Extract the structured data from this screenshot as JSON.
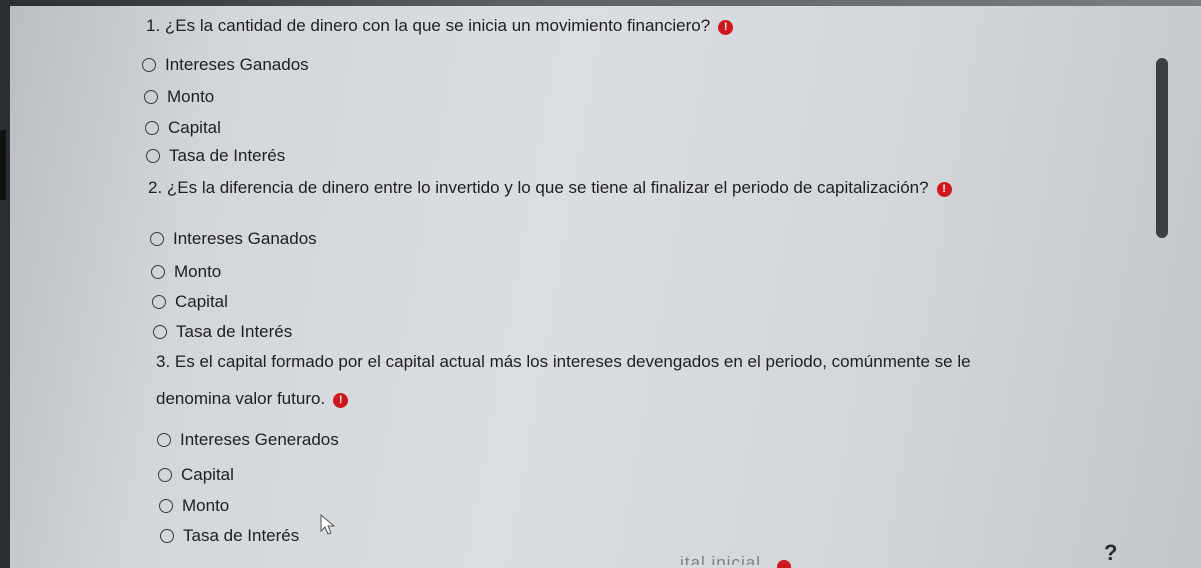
{
  "questions": [
    {
      "text": "1. ¿Es la cantidad de dinero con la que se inicia un movimiento financiero?",
      "required_mark": "!",
      "options": [
        "Intereses Ganados",
        "Monto",
        "Capital",
        "Tasa de Interés"
      ]
    },
    {
      "text": "2. ¿Es la diferencia de dinero entre lo invertido y lo que se tiene al finalizar el periodo de capitalización?",
      "required_mark": "!",
      "options": [
        "Intereses Ganados",
        "Monto",
        "Capital",
        "Tasa de Interés"
      ]
    },
    {
      "text_line1": "3. Es el capital formado por el capital actual más los intereses devengados en el periodo, comúnmente se le",
      "text_line2": "denomina valor futuro.",
      "required_mark": "!",
      "options": [
        "Intereses Generados",
        "Capital",
        "Monto",
        "Tasa de Interés"
      ]
    }
  ],
  "help_button": "?",
  "partial_text": "ital inicial",
  "colors": {
    "required_badge": "#d0181c",
    "text": "#1f1f22"
  }
}
